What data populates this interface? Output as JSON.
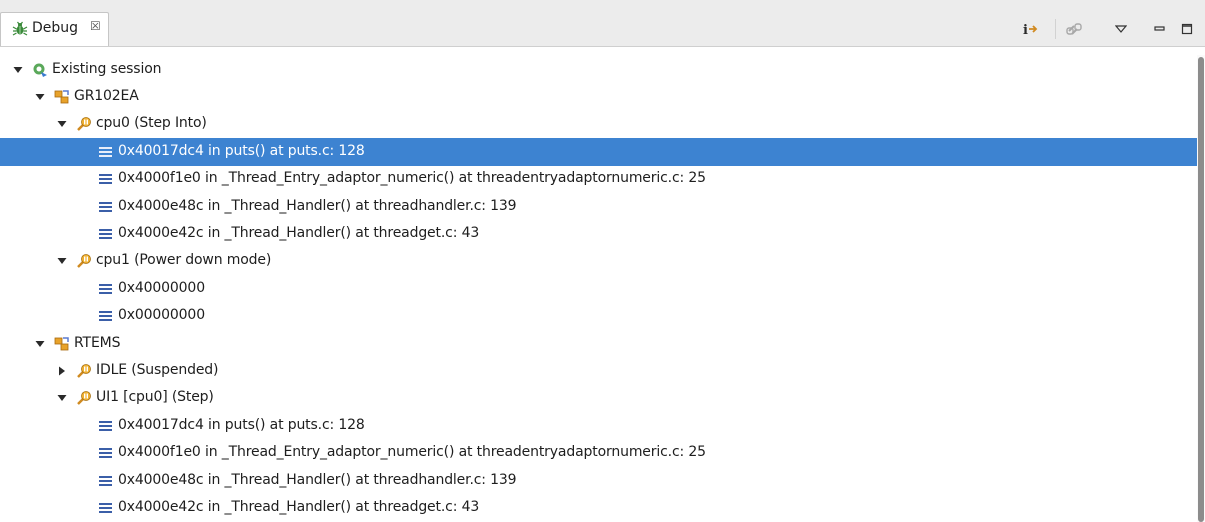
{
  "view": {
    "title": "Debug",
    "close_glyph": "☒"
  },
  "toolbar": {
    "buttons": [
      {
        "name": "step-filters-toggle-icon"
      },
      {
        "name": "link-with-editor-icon"
      },
      {
        "name": "view-menu-icon"
      },
      {
        "name": "minimize-icon"
      },
      {
        "name": "maximize-icon"
      }
    ]
  },
  "tree": [
    {
      "label": "Existing session",
      "icon": "launch-session-icon",
      "expanded": true
    },
    {
      "label": "GR102EA",
      "icon": "debug-target-icon",
      "expanded": true
    },
    {
      "label": "cpu0 (Step Into)",
      "icon": "thread-suspended-icon",
      "expanded": true
    },
    {
      "label": "0x40017dc4 in puts() at puts.c: 128",
      "icon": "stack-frame-icon",
      "selected": true
    },
    {
      "label": "0x4000f1e0 in _Thread_Entry_adaptor_numeric() at threadentryadaptornumeric.c: 25",
      "icon": "stack-frame-icon"
    },
    {
      "label": "0x4000e48c in _Thread_Handler() at threadhandler.c: 139",
      "icon": "stack-frame-icon"
    },
    {
      "label": "0x4000e42c in _Thread_Handler() at threadget.c: 43",
      "icon": "stack-frame-icon"
    },
    {
      "label": "cpu1 (Power down mode)",
      "icon": "thread-suspended-icon",
      "expanded": true
    },
    {
      "label": "0x40000000",
      "icon": "stack-frame-icon"
    },
    {
      "label": "0x00000000",
      "icon": "stack-frame-icon"
    },
    {
      "label": "RTEMS",
      "icon": "debug-target-icon",
      "expanded": true
    },
    {
      "label": "IDLE (Suspended)",
      "icon": "thread-suspended-icon",
      "expanded": false
    },
    {
      "label": "UI1  [cpu0] (Step)",
      "icon": "thread-suspended-icon",
      "expanded": true
    },
    {
      "label": "0x40017dc4 in puts() at puts.c: 128",
      "icon": "stack-frame-icon"
    },
    {
      "label": "0x4000f1e0 in _Thread_Entry_adaptor_numeric() at threadentryadaptornumeric.c: 25",
      "icon": "stack-frame-icon"
    },
    {
      "label": "0x4000e48c in _Thread_Handler() at threadhandler.c: 139",
      "icon": "stack-frame-icon"
    },
    {
      "label": "0x4000e42c in _Thread_Handler() at threadget.c: 43",
      "icon": "stack-frame-icon"
    }
  ],
  "colors": {
    "selection": "#3d83d1",
    "frame_icon": "#3b5fa8",
    "thread_icon": "#e0a020",
    "session_icon": "#3a9a3a"
  }
}
